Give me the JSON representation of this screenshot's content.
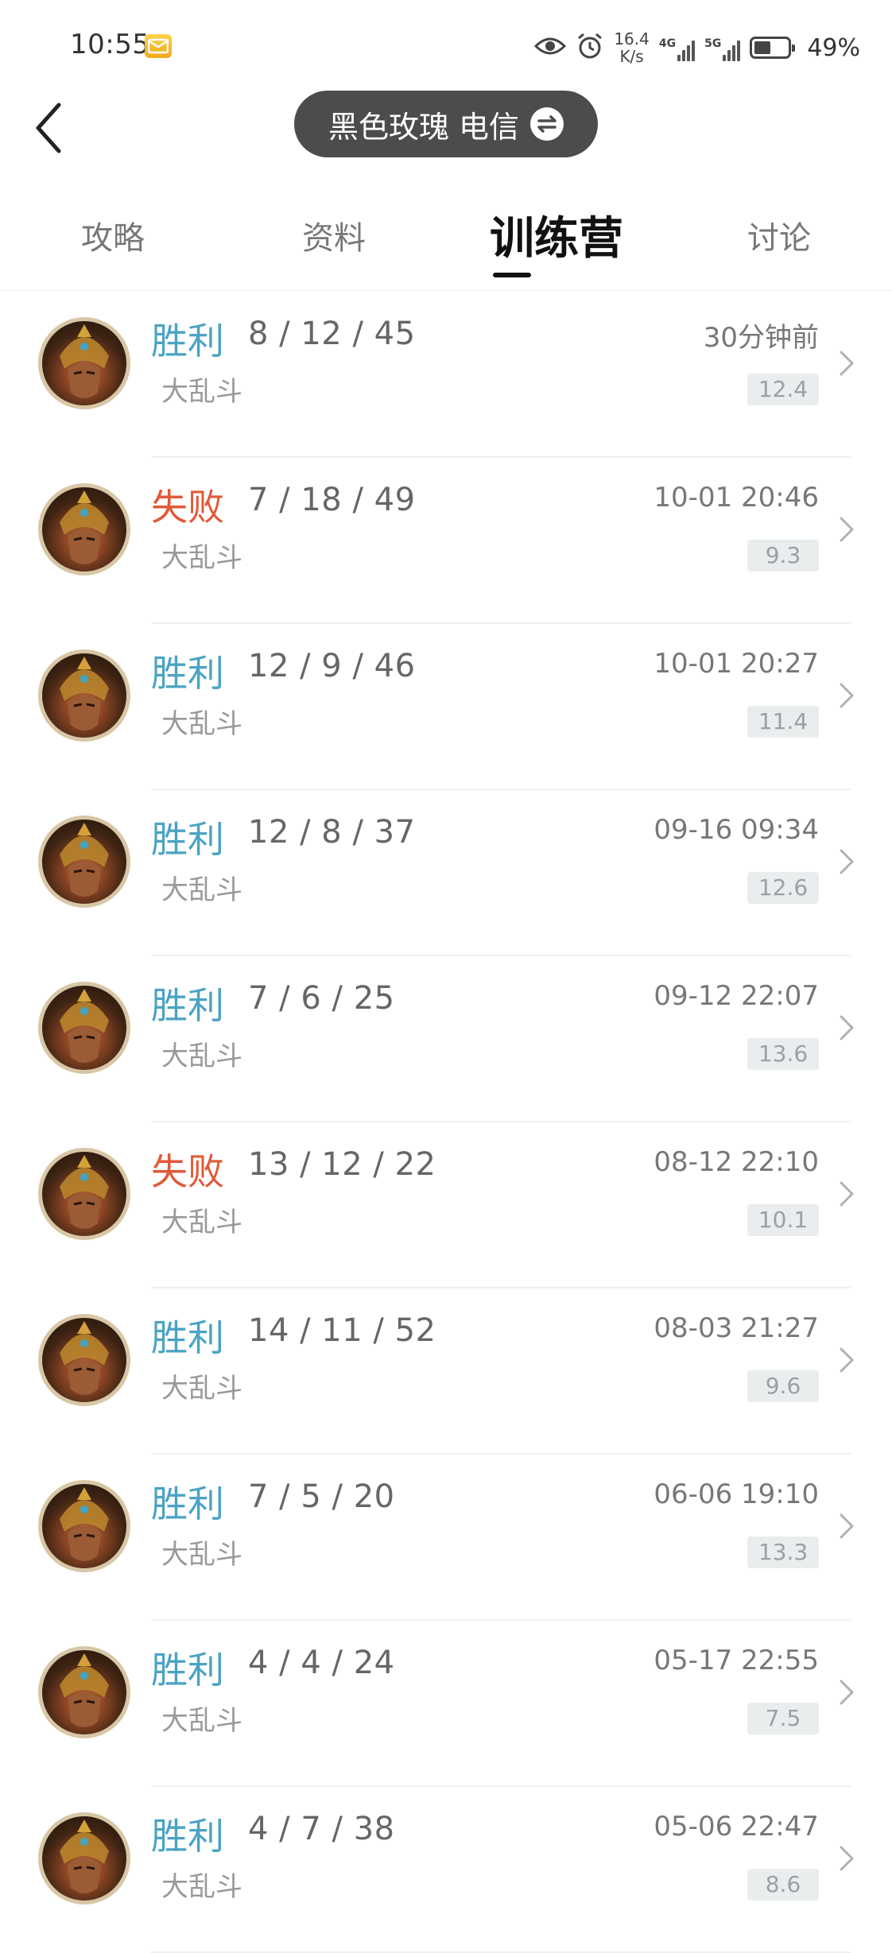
{
  "status_bar": {
    "time": "10:55",
    "net_speed_value": "16.4",
    "net_speed_unit": "K/s",
    "signal_1": "4G",
    "signal_2": "5G",
    "battery": "49%"
  },
  "header": {
    "account": "黑色玫瑰 电信"
  },
  "tabs": [
    {
      "label": "攻略",
      "active": false
    },
    {
      "label": "资料",
      "active": false
    },
    {
      "label": "训练营",
      "active": true
    },
    {
      "label": "讨论",
      "active": false
    }
  ],
  "matches": [
    {
      "result": "胜利",
      "outcome": "win",
      "kda": "8 / 12 / 45",
      "mode": "大乱斗",
      "time": "30分钟前",
      "score": "12.4"
    },
    {
      "result": "失败",
      "outcome": "lose",
      "kda": "7 / 18 / 49",
      "mode": "大乱斗",
      "time": "10-01 20:46",
      "score": "9.3"
    },
    {
      "result": "胜利",
      "outcome": "win",
      "kda": "12 / 9 / 46",
      "mode": "大乱斗",
      "time": "10-01 20:27",
      "score": "11.4"
    },
    {
      "result": "胜利",
      "outcome": "win",
      "kda": "12 / 8 / 37",
      "mode": "大乱斗",
      "time": "09-16 09:34",
      "score": "12.6"
    },
    {
      "result": "胜利",
      "outcome": "win",
      "kda": "7 / 6 / 25",
      "mode": "大乱斗",
      "time": "09-12 22:07",
      "score": "13.6"
    },
    {
      "result": "失败",
      "outcome": "lose",
      "kda": "13 / 12 / 22",
      "mode": "大乱斗",
      "time": "08-12 22:10",
      "score": "10.1"
    },
    {
      "result": "胜利",
      "outcome": "win",
      "kda": "14 / 11 / 52",
      "mode": "大乱斗",
      "time": "08-03 21:27",
      "score": "9.6"
    },
    {
      "result": "胜利",
      "outcome": "win",
      "kda": "7 / 5 / 20",
      "mode": "大乱斗",
      "time": "06-06 19:10",
      "score": "13.3"
    },
    {
      "result": "胜利",
      "outcome": "win",
      "kda": "4 / 4 / 24",
      "mode": "大乱斗",
      "time": "05-17 22:55",
      "score": "7.5"
    },
    {
      "result": "胜利",
      "outcome": "win",
      "kda": "4 / 7 / 38",
      "mode": "大乱斗",
      "time": "05-06 22:47",
      "score": "8.6"
    }
  ],
  "colors": {
    "win": "#4aa3c4",
    "lose": "#e05a38",
    "pill": "#4c4c4c"
  },
  "icons": {
    "back": "chevron-left-icon",
    "switch": "swap-icon",
    "row_arrow": "chevron-right-icon",
    "mail": "mail-icon",
    "eye": "eye-icon",
    "alarm": "alarm-icon"
  }
}
